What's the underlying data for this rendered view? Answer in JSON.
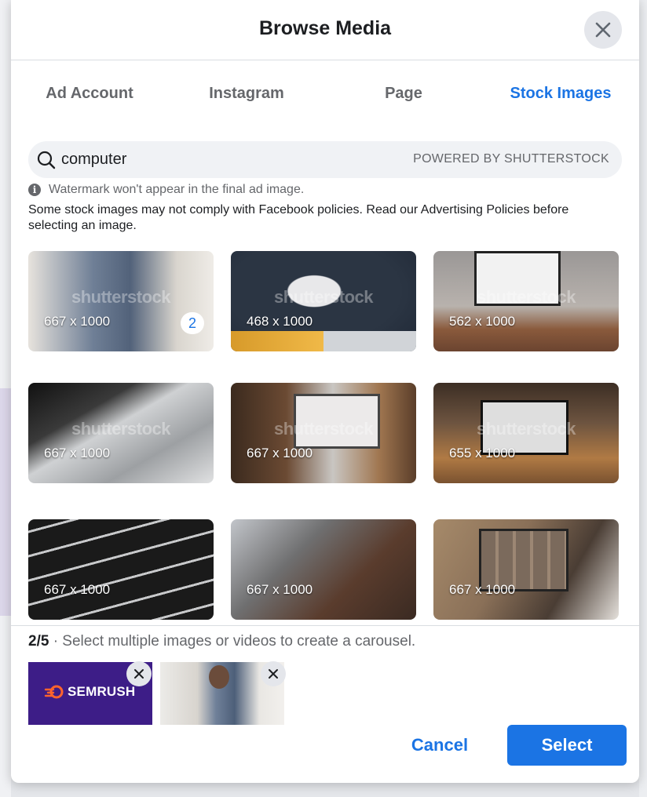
{
  "modal": {
    "title": "Browse Media"
  },
  "tabs": [
    {
      "label": "Ad Account",
      "active": false
    },
    {
      "label": "Instagram",
      "active": false
    },
    {
      "label": "Page",
      "active": false
    },
    {
      "label": "Stock Images",
      "active": true
    }
  ],
  "search": {
    "value": "computer",
    "powered_by": "POWERED BY SHUTTERSTOCK"
  },
  "notice": {
    "watermark": "Watermark won't appear in the final ad image.",
    "policy": "Some stock images may not comply with Facebook policies. Read our Advertising Policies before selecting an image."
  },
  "watermark_text": "shutterstock",
  "images": [
    {
      "dimensions": "667 x 1000",
      "selected_index": "2"
    },
    {
      "dimensions": "468 x 1000"
    },
    {
      "dimensions": "562 x 1000"
    },
    {
      "dimensions": "667 x 1000"
    },
    {
      "dimensions": "667 x 1000"
    },
    {
      "dimensions": "655 x 1000"
    },
    {
      "dimensions": "667 x 1000"
    },
    {
      "dimensions": "667 x 1000"
    },
    {
      "dimensions": "667 x 1000"
    }
  ],
  "selection": {
    "count": "2/5",
    "hint": " · Select multiple images or videos to create a carousel.",
    "thumbnails": [
      {
        "label": "SEMRUSH"
      },
      {
        "label": ""
      }
    ]
  },
  "buttons": {
    "cancel": "Cancel",
    "select": "Select"
  },
  "colors": {
    "accent": "#1b74e4",
    "semrush_bg": "#3d1d87",
    "semrush_logo": "#ff642d"
  }
}
